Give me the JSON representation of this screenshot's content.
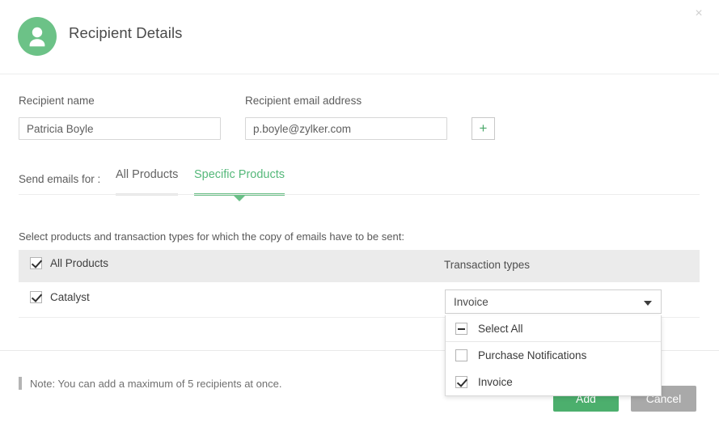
{
  "dialog": {
    "title": "Recipient Details",
    "close_label": "×",
    "avatar_icon": "user-avatar-icon",
    "accent_color": "#6cc287"
  },
  "form": {
    "name_label": "Recipient name",
    "name_value": "Patricia Boyle",
    "name_placeholder": "Recipient name",
    "email_label": "Recipient email address",
    "email_value": "p.boyle@zylker.com",
    "email_placeholder": "Recipient email address",
    "add_row_label": "+"
  },
  "tabs": {
    "prefix_label": "Send emails for :",
    "items": [
      {
        "label": "All Products",
        "active": false
      },
      {
        "label": "Specific Products",
        "active": true
      }
    ]
  },
  "instruction": "Select products and transaction types for which the copy of emails have to be sent:",
  "table": {
    "header": {
      "select_all_label": "All Products",
      "select_all_checked": true,
      "transaction_col_label": "Transaction types"
    },
    "rows": [
      {
        "product": "Catalyst",
        "checked": true,
        "transaction_selected": "Invoice"
      }
    ]
  },
  "dropdown": {
    "selected_value": "Invoice",
    "caret_icon": "chevron-down-icon",
    "options": [
      {
        "label": "Select All",
        "state": "indeterminate"
      },
      {
        "label": "Purchase Notifications",
        "state": "unchecked"
      },
      {
        "label": "Invoice",
        "state": "checked"
      }
    ]
  },
  "footer": {
    "note": "Note: You can add a maximum of 5 recipients at once.",
    "primary_button": "Add",
    "secondary_button": "Cancel",
    "primary_color": "#4caf6d",
    "secondary_color": "#a9a9a9"
  }
}
